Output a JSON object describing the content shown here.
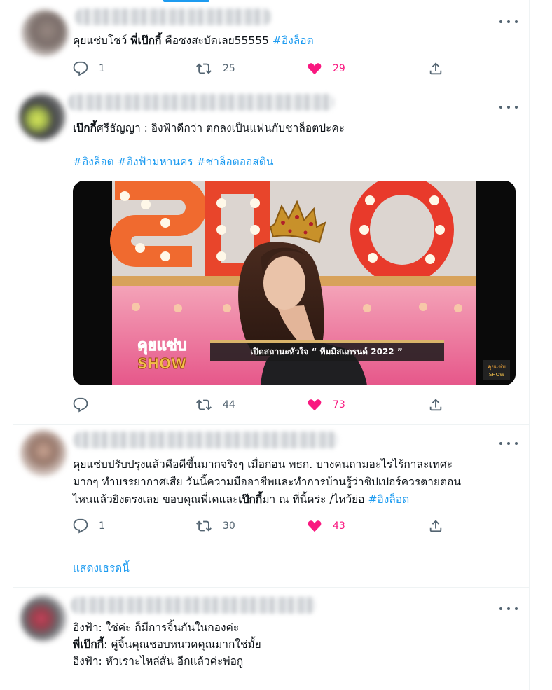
{
  "tweets": [
    {
      "lines": [
        [
          {
            "t": "คุยแซ่บโชว์ ",
            "s": "normal"
          },
          {
            "t": "พี่เป๊กกี้",
            "s": "bold"
          },
          {
            "t": " คือชงสะบัดเลย55555 ",
            "s": "normal"
          },
          {
            "t": "#อิงล็อต",
            "s": "tag"
          }
        ]
      ],
      "replies": "1",
      "retweets": "25",
      "likes": "29"
    },
    {
      "lines": [
        [
          {
            "t": "เป๊กกี้",
            "s": "bold"
          },
          {
            "t": "ศรีธัญญา : อิงฟ้าดีกว่า ตกลงเป็นแฟนกับชาล็อตปะคะ",
            "s": "normal"
          }
        ]
      ],
      "hashtags": [
        "#อิงล็อต",
        "#อิงฟ้ามหานคร",
        "#ชาล็อตออสติน"
      ],
      "media": {
        "sign_letters": "SHO",
        "logo_line1": "คุยแซ่บ",
        "logo_line2": "SHOW",
        "caption": "เปิดสถานะหัวใจ “ ทีมมิสแกรนด์ 2022 ”",
        "watermark_line1": "คุยแซ่บ",
        "watermark_line2": "SHOW"
      },
      "replies": "",
      "retweets": "44",
      "likes": "73"
    },
    {
      "lines": [
        [
          {
            "t": "คุยแซ่บปรับปรุงแล้วคือดีขึ้นมากจริงๆ เมื่อก่อน พธก. บางคนถามอะไรไร้กาละเทศะ",
            "s": "normal"
          }
        ],
        [
          {
            "t": "มากๆ ทำบรรยากาศเสีย วันนี้ความมืออาชีพและทำการบ้านรู้ว่าชิปเปอร์ควรตายตอน",
            "s": "normal"
          }
        ],
        [
          {
            "t": "ไหนแล้วยิงตรงเลย ขอบคุณพี่เคและ",
            "s": "normal"
          },
          {
            "t": "เป๊กกี้",
            "s": "bold"
          },
          {
            "t": "มา ณ ที่นี้คร่ะ /ไหว้ย่อ ",
            "s": "normal"
          },
          {
            "t": "#อิงล็อต",
            "s": "tag"
          }
        ]
      ],
      "replies": "1",
      "retweets": "30",
      "likes": "43",
      "show_thread": "แสดงเธรดนี้"
    },
    {
      "lines": [
        [
          {
            "t": "อิงฟ้า: ใช่ค่ะ ก็มีการจิ้นกันในกองค่ะ",
            "s": "normal"
          }
        ],
        [
          {
            "t": "พี่เป๊กกี้",
            "s": "bold"
          },
          {
            "t": ": คู่จิ้นคุณชอบหนวดคุณมากใช่มั้ย",
            "s": "normal"
          }
        ],
        [
          {
            "t": "อิงฟ้า: หัวเราะไหล่สั่น อีกแล้วค่ะพ่อกู",
            "s": "normal"
          }
        ]
      ]
    }
  ],
  "colors": {
    "accent": "#1d9bf0",
    "like": "#f91880",
    "icon": "#536471"
  },
  "icons": {
    "reply": "reply-icon",
    "retweet": "retweet-icon",
    "like": "heart-icon",
    "share": "share-icon",
    "more": "more-icon"
  }
}
